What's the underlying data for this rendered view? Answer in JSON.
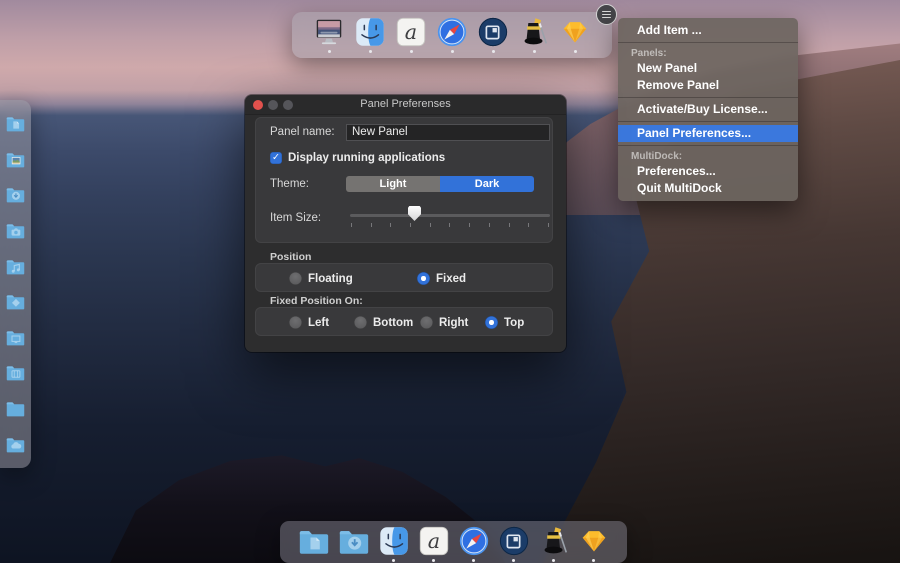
{
  "colors": {
    "accent_blue": "#3272d9",
    "menu_highlight": "#3b78dd",
    "close_red": "#e1514d"
  },
  "glyphs": {
    "checkmark": "✓"
  },
  "top_dock": {
    "items": [
      {
        "name": "display",
        "running": true
      },
      {
        "name": "finder",
        "running": true
      },
      {
        "name": "script-a",
        "running": true
      },
      {
        "name": "safari",
        "running": true
      },
      {
        "name": "multidock",
        "running": true
      },
      {
        "name": "magic-hat",
        "running": true
      },
      {
        "name": "sketch",
        "running": true
      }
    ]
  },
  "context_menu": {
    "items": [
      {
        "type": "item",
        "label": "Add Item ..."
      },
      {
        "type": "separator"
      },
      {
        "type": "header",
        "label": "Panels:"
      },
      {
        "type": "item",
        "label": "New Panel"
      },
      {
        "type": "item",
        "label": "Remove Panel"
      },
      {
        "type": "separator"
      },
      {
        "type": "item",
        "label": "Activate/Buy License..."
      },
      {
        "type": "separator"
      },
      {
        "type": "item",
        "label": "Panel Preferences...",
        "highlighted": true
      },
      {
        "type": "separator"
      },
      {
        "type": "header",
        "label": "MultiDock:"
      },
      {
        "type": "item",
        "label": "Preferences..."
      },
      {
        "type": "item",
        "label": "Quit MultiDock"
      }
    ]
  },
  "dialog": {
    "title": "Panel Preferenses",
    "panel_name_label": "Panel name:",
    "panel_name_value": "New Panel",
    "display_running_label": "Display running applications",
    "display_running_checked": true,
    "theme_label": "Theme:",
    "theme_options": [
      "Light",
      "Dark"
    ],
    "theme_selected": "Dark",
    "item_size_label": "Item Size:",
    "item_size_value_percent": 32,
    "item_size_tick_count": 11,
    "position_label": "Position",
    "position_options": [
      "Floating",
      "Fixed"
    ],
    "position_selected": "Fixed",
    "fixed_position_label": "Fixed Position On:",
    "fixed_position_options": [
      "Left",
      "Bottom",
      "Right",
      "Top"
    ],
    "fixed_position_selected": "Top"
  },
  "left_dock": {
    "items": [
      {
        "name": "folder-documents"
      },
      {
        "name": "folder-photos"
      },
      {
        "name": "folder-downloads"
      },
      {
        "name": "folder-camera"
      },
      {
        "name": "folder-music"
      },
      {
        "name": "folder-diamond"
      },
      {
        "name": "folder-desktop"
      },
      {
        "name": "folder-movies"
      },
      {
        "name": "folder-plain"
      },
      {
        "name": "folder-cloud"
      }
    ]
  },
  "bottom_dock": {
    "items": [
      {
        "name": "folder-documents",
        "running": false
      },
      {
        "name": "folder-downloads",
        "running": false
      },
      {
        "name": "finder",
        "running": true
      },
      {
        "name": "script-a",
        "running": true
      },
      {
        "name": "safari",
        "running": true
      },
      {
        "name": "multidock",
        "running": true
      },
      {
        "name": "magic-hat",
        "running": true
      },
      {
        "name": "sketch",
        "running": true
      }
    ]
  }
}
